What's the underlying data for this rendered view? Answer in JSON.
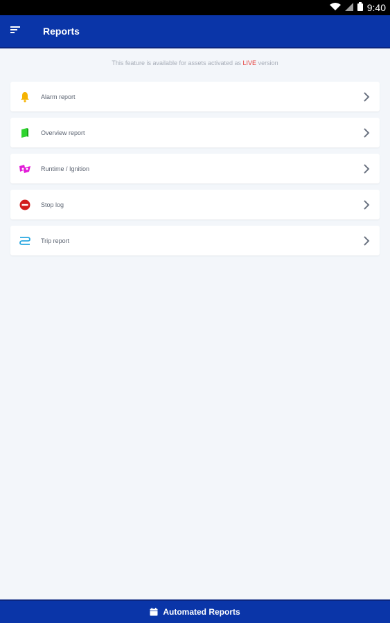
{
  "status_bar": {
    "time": "9:40",
    "icons": [
      "wifi-icon",
      "signal-icon",
      "battery-icon"
    ]
  },
  "app_bar": {
    "title": "Reports",
    "menu_icon": "menu-icon",
    "color": "#0a35a8"
  },
  "notice": {
    "prefix": "This feature is available for assets activated as",
    "highlight": "LIVE",
    "suffix": "version",
    "highlight_color": "#e53935"
  },
  "reports": [
    {
      "label": "Alarm report",
      "icon": "bell-icon",
      "icon_color": "#f5b301"
    },
    {
      "label": "Overview report",
      "icon": "book-icon",
      "icon_color": "#2fd42f"
    },
    {
      "label": "Runtime / Ignition",
      "icon": "runtime-icon",
      "icon_color": "#e21cd8"
    },
    {
      "label": "Stop log",
      "icon": "stop-icon",
      "icon_color": "#d21d1d"
    },
    {
      "label": "Trip report",
      "icon": "trip-icon",
      "icon_color": "#29a7e0"
    }
  ],
  "bottom_bar": {
    "label": "Automated Reports",
    "icon": "calendar-icon"
  }
}
